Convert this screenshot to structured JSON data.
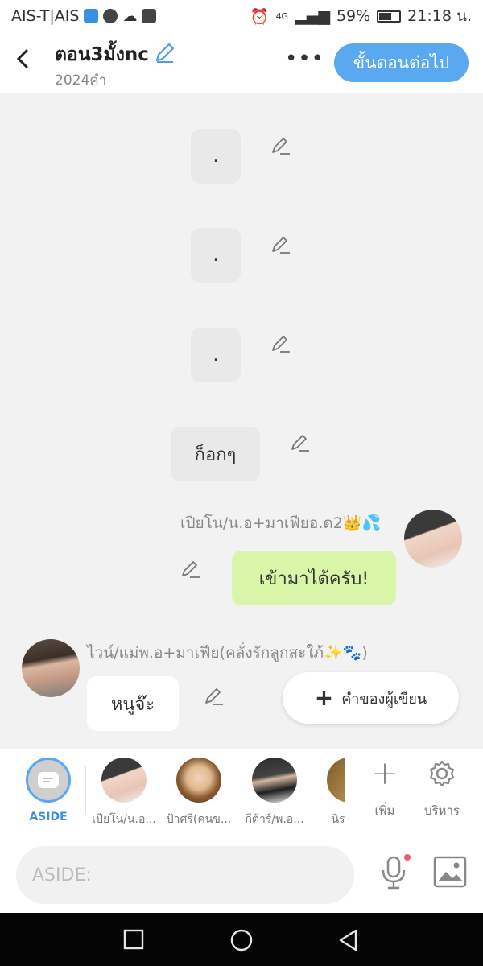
{
  "status_bar": {
    "carrier": "AIS-T|AIS",
    "network": "4G",
    "battery": "59%",
    "time": "21:18 น."
  },
  "header": {
    "title": "ตอน3มั้งnc",
    "word_count": "2024คำ",
    "next_button": "ขั้นตอนต่อไป"
  },
  "messages": [
    {
      "type": "narration",
      "text": "."
    },
    {
      "type": "narration",
      "text": "."
    },
    {
      "type": "narration",
      "text": "."
    },
    {
      "type": "narration",
      "text": "ก็อกๆ"
    },
    {
      "type": "character",
      "side": "right",
      "name": "เปียโน/น.อ+มาเฟียอ.ด2👑💦",
      "text": "เข้ามาได้ครับ!"
    },
    {
      "type": "character",
      "side": "left",
      "name": "ไวน์/แม่พ.อ+มาเฟีย(คลั่งรักลูกสะใภ้✨🐾)",
      "text": "หนูจ๊ะ"
    }
  ],
  "writer_button": "คำของผู้เขียน",
  "character_bar": {
    "aside_label": "ASIDE",
    "characters": [
      {
        "label": "เปียโน/น.อ..."
      },
      {
        "label": "ป้าศรี(คนข..."
      },
      {
        "label": "กีต้าร์/พ.อ..."
      },
      {
        "label": "นิร"
      }
    ],
    "add_label": "เพิ่ม",
    "manage_label": "บริหาร"
  },
  "input": {
    "placeholder": "ASIDE:"
  },
  "colors": {
    "accent": "#5aa9f0",
    "right_bubble": "#d9f5a8",
    "narration_bubble": "#e9e9e9"
  }
}
